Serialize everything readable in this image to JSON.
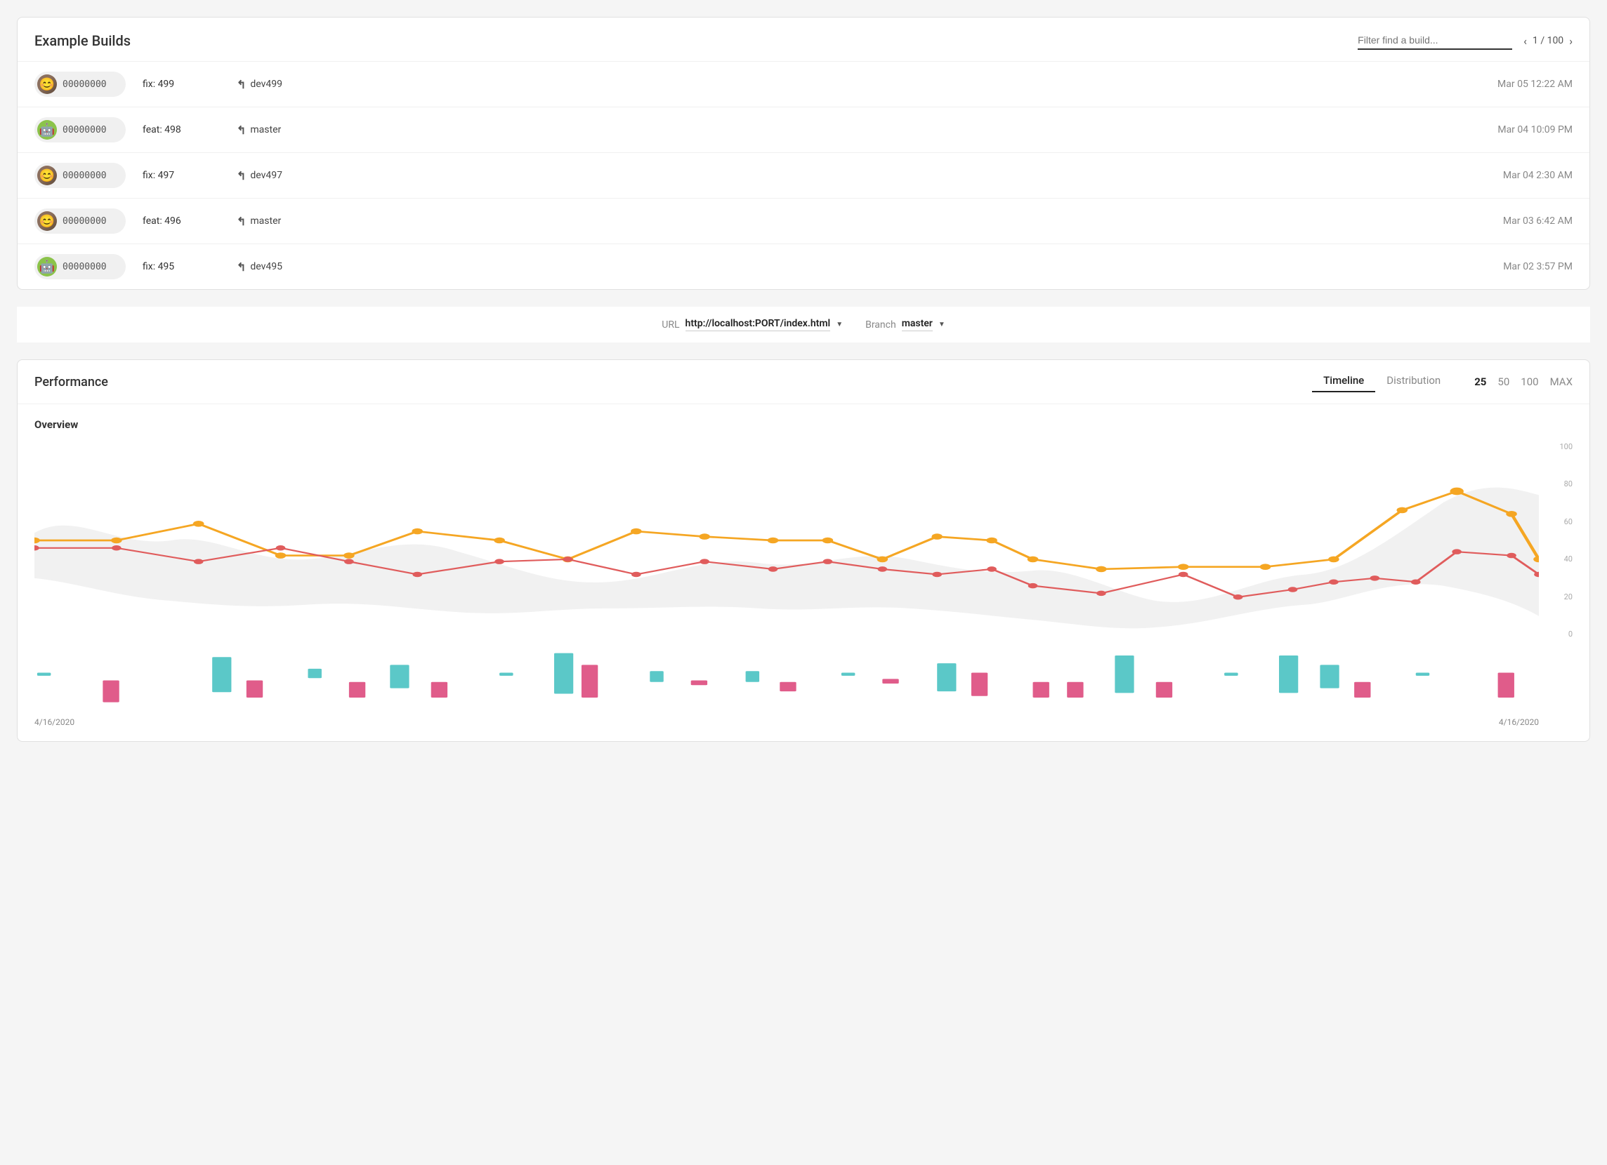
{
  "builds": {
    "title": "Example Builds",
    "filter_placeholder": "Filter find a build...",
    "pagination": {
      "current": 1,
      "total": 100,
      "label": "1 / 100"
    },
    "rows": [
      {
        "id": "00000000",
        "label": "fix: 499",
        "branch": "dev499",
        "date": "Mar 05 12:22 AM",
        "avatar_type": "human"
      },
      {
        "id": "00000000",
        "label": "feat: 498",
        "branch": "master",
        "date": "Mar 04 10:09 PM",
        "avatar_type": "android"
      },
      {
        "id": "00000000",
        "label": "fix: 497",
        "branch": "dev497",
        "date": "Mar 04 2:30 AM",
        "avatar_type": "human"
      },
      {
        "id": "00000000",
        "label": "feat: 496",
        "branch": "master",
        "date": "Mar 03 6:42 AM",
        "avatar_type": "human"
      },
      {
        "id": "00000000",
        "label": "fix: 495",
        "branch": "dev495",
        "date": "Mar 02 3:57 PM",
        "avatar_type": "android"
      }
    ]
  },
  "selector": {
    "url_label": "URL",
    "url_value": "http://localhost:PORT/index.html",
    "branch_label": "Branch",
    "branch_value": "master"
  },
  "performance": {
    "title": "Performance",
    "tabs": [
      "Timeline",
      "Distribution"
    ],
    "active_tab": "Timeline",
    "counts": [
      "25",
      "50",
      "100",
      "MAX"
    ],
    "active_count": "25",
    "overview_title": "Overview",
    "y_axis": [
      "100",
      "80",
      "60",
      "40",
      "20",
      "0"
    ],
    "date_start": "4/16/2020",
    "date_end": "4/16/2020",
    "colors": {
      "orange_line": "#F5A623",
      "red_line": "#E05C5C",
      "area_fill": "#E8E8E8",
      "bar_teal": "#5BC8C8",
      "bar_pink": "#E05C8A"
    }
  }
}
